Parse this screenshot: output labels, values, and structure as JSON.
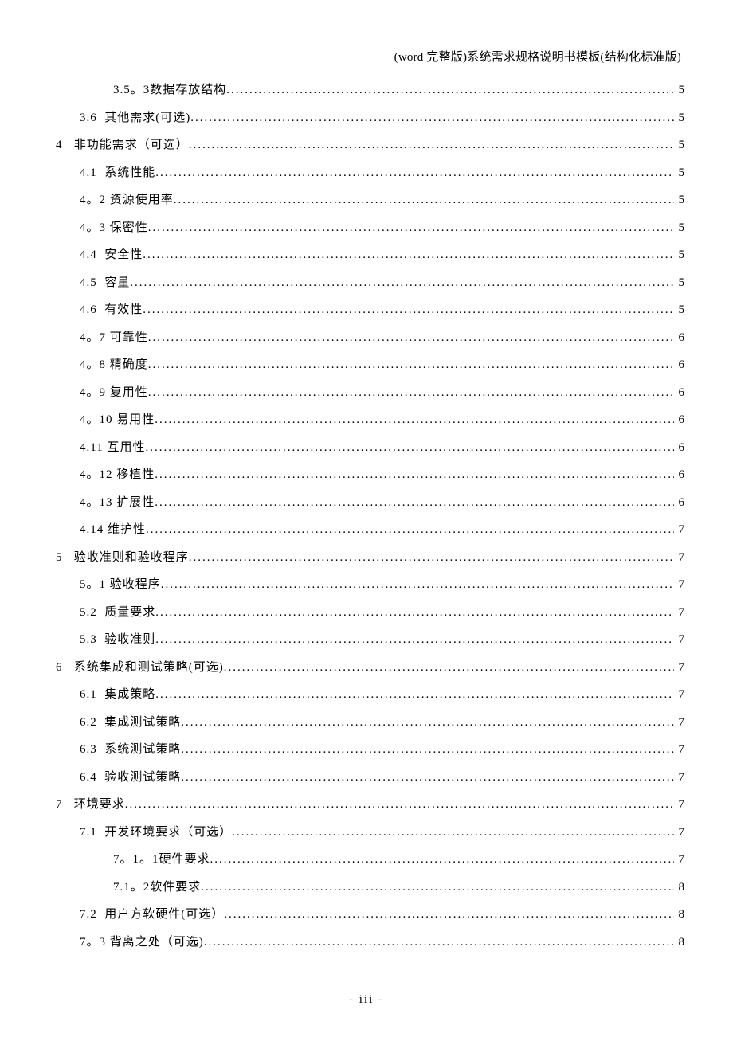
{
  "header": {
    "right_text": "(word 完整版)系统需求规格说明书模板(结构化标准版)"
  },
  "toc": [
    {
      "level": 3,
      "label": "3.5。3数据存放结构",
      "page": "5"
    },
    {
      "level": 2,
      "label": "3.6  其他需求(可选)",
      "page": "5"
    },
    {
      "level": 1,
      "label": "4   非功能需求（可选）",
      "page": "5"
    },
    {
      "level": 2,
      "label": "4.1  系统性能",
      "page": "5"
    },
    {
      "level": 2,
      "label": "4。2 资源使用率",
      "page": "5"
    },
    {
      "level": 2,
      "label": "4。3 保密性",
      "page": "5"
    },
    {
      "level": 2,
      "label": "4.4  安全性",
      "page": "5"
    },
    {
      "level": 2,
      "label": "4.5  容量",
      "page": "5"
    },
    {
      "level": 2,
      "label": "4.6  有效性",
      "page": "5"
    },
    {
      "level": 2,
      "label": "4。7 可靠性",
      "page": "6"
    },
    {
      "level": 2,
      "label": "4。8 精确度",
      "page": "6"
    },
    {
      "level": 2,
      "label": "4。9 复用性",
      "page": "6"
    },
    {
      "level": 2,
      "label": "4。10 易用性",
      "page": "6"
    },
    {
      "level": 2,
      "label": "4.11 互用性",
      "page": "6"
    },
    {
      "level": 2,
      "label": "4。12 移植性",
      "page": "6"
    },
    {
      "level": 2,
      "label": "4。13 扩展性",
      "page": "6"
    },
    {
      "level": 2,
      "label": "4.14 维护性",
      "page": "7"
    },
    {
      "level": 1,
      "label": "5   验收准则和验收程序",
      "page": "7"
    },
    {
      "level": 2,
      "label": "5。1 验收程序",
      "page": "7"
    },
    {
      "level": 2,
      "label": "5.2  质量要求",
      "page": "7"
    },
    {
      "level": 2,
      "label": "5.3  验收准则",
      "page": "7"
    },
    {
      "level": 1,
      "label": "6   系统集成和测试策略(可选)",
      "page": "7"
    },
    {
      "level": 2,
      "label": "6.1  集成策略",
      "page": "7"
    },
    {
      "level": 2,
      "label": "6.2  集成测试策略",
      "page": "7"
    },
    {
      "level": 2,
      "label": "6.3  系统测试策略",
      "page": "7"
    },
    {
      "level": 2,
      "label": "6.4  验收测试策略",
      "page": "7"
    },
    {
      "level": 1,
      "label": "7   环境要求",
      "page": "7"
    },
    {
      "level": 2,
      "label": "7.1  开发环境要求（可选）",
      "page": "7"
    },
    {
      "level": 3,
      "label": "7。1。1硬件要求",
      "page": "7"
    },
    {
      "level": 3,
      "label": "7.1。2软件要求",
      "page": "8"
    },
    {
      "level": 2,
      "label": "7.2  用户方软硬件(可选）",
      "page": "8"
    },
    {
      "level": 2,
      "label": "7。3 背离之处（可选)",
      "page": "8"
    }
  ],
  "footer": {
    "page_label": "- iii -"
  }
}
